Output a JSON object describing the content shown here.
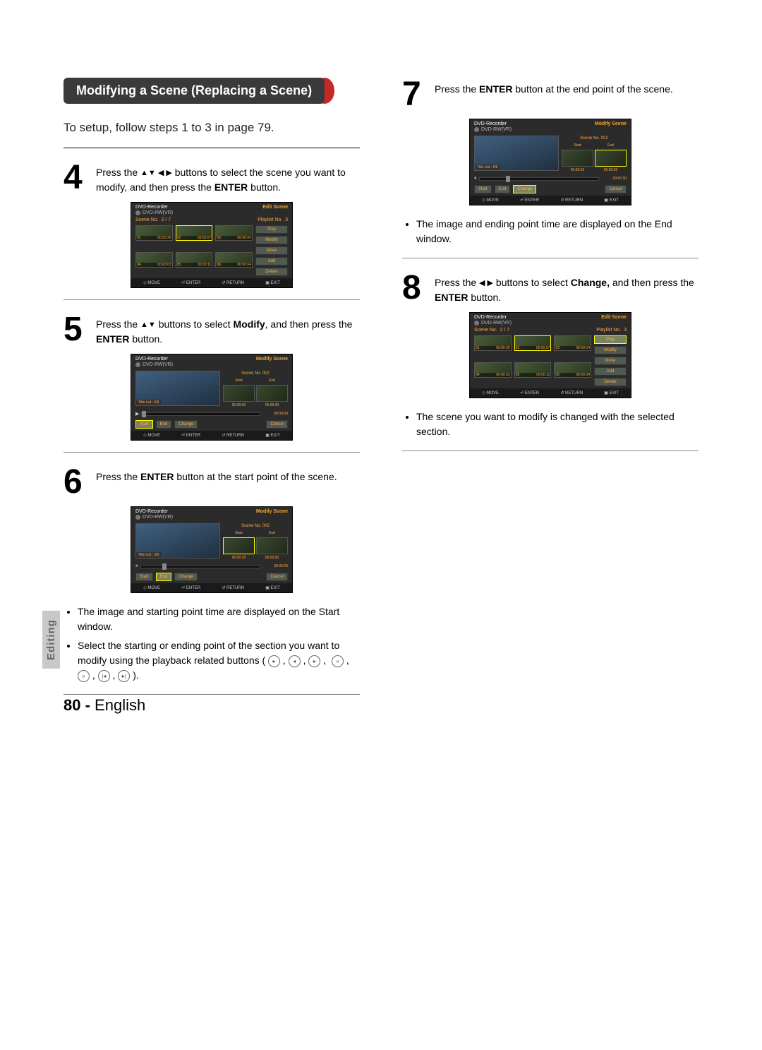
{
  "sideTab": "Editing",
  "pageNumber": "80 -",
  "pageLang": "English",
  "sectionTitle": "Modifying a Scene (Replacing a Scene)",
  "setupNote": "To setup, follow steps 1 to 3 in page 79.",
  "steps": {
    "s4": {
      "num": "4",
      "text_a": "Press the ",
      "text_b": " buttons to select the scene you want to modify, and then press the ",
      "enter": "ENTER",
      "text_c": " button."
    },
    "s5": {
      "num": "5",
      "text_a": "Press the ",
      "text_b": " buttons to select ",
      "modify": "Modify",
      "text_c": ", and then press the ",
      "enter": "ENTER",
      "text_d": " button."
    },
    "s6": {
      "num": "6",
      "text_a": "Press the ",
      "enter": "ENTER",
      "text_b": " button at the start point of the scene.",
      "bullets": [
        "The image and starting point time are displayed on the Start window.",
        "Select the starting or ending point of the section you want to modify using the playback related buttons ("
      ],
      "bullet2_tail": ")."
    },
    "s7": {
      "num": "7",
      "text_a": "Press the ",
      "enter": "ENTER",
      "text_b": " button at the end point of the scene.",
      "bullet": "The image and ending point time are displayed on the End window."
    },
    "s8": {
      "num": "8",
      "text_a": "Press the ",
      "text_b": " buttons to select ",
      "change": "Change,",
      "text_c": " and then press the ",
      "enter": "ENTER",
      "text_d": " button.",
      "bullet": "The scene you want to modify is changed with the selected section."
    }
  },
  "osd": {
    "device": "DVD-Recorder",
    "disc": "DVD-RW(VR)",
    "editScene": "Edit Scene",
    "modifyScene": "Modify Scene",
    "sceneNoLabel": "Scene No.",
    "sceneNoVal": "2 / 7",
    "playlistLabel": "Playlist No.",
    "playlistVal": "3",
    "thumbs": [
      {
        "n": "01",
        "t": "00:00:26"
      },
      {
        "n": "02",
        "t": "00:00:07"
      },
      {
        "n": "03",
        "t": "00:00:04"
      },
      {
        "n": "04",
        "t": "00:00:03"
      },
      {
        "n": "05",
        "t": "00:00:11"
      },
      {
        "n": "06",
        "t": "00:00:04"
      }
    ],
    "sideButtons": [
      "Play",
      "Modify",
      "Move",
      "Add",
      "Delete"
    ],
    "footer": {
      "move": "MOVE",
      "enter": "ENTER",
      "return": "RETURN",
      "exit": "EXIT"
    },
    "modify": {
      "titleList": "Title List : 5/6",
      "sceneNo": "Scene No. 002",
      "start": "Start",
      "end": "End",
      "btnStart": "Start",
      "btnEnd": "End",
      "btnChange": "Change",
      "btnCancel": "Cancel",
      "t_zero": "00:00:00",
      "p5_bar": "00:00:00",
      "p6_start": "00:00:25",
      "p6_end": "00:00:00",
      "p6_bar": "00:00:25",
      "p7_start": "00:00:25",
      "p7_end": "00:00:30",
      "p7_bar": "00:00:30"
    }
  }
}
